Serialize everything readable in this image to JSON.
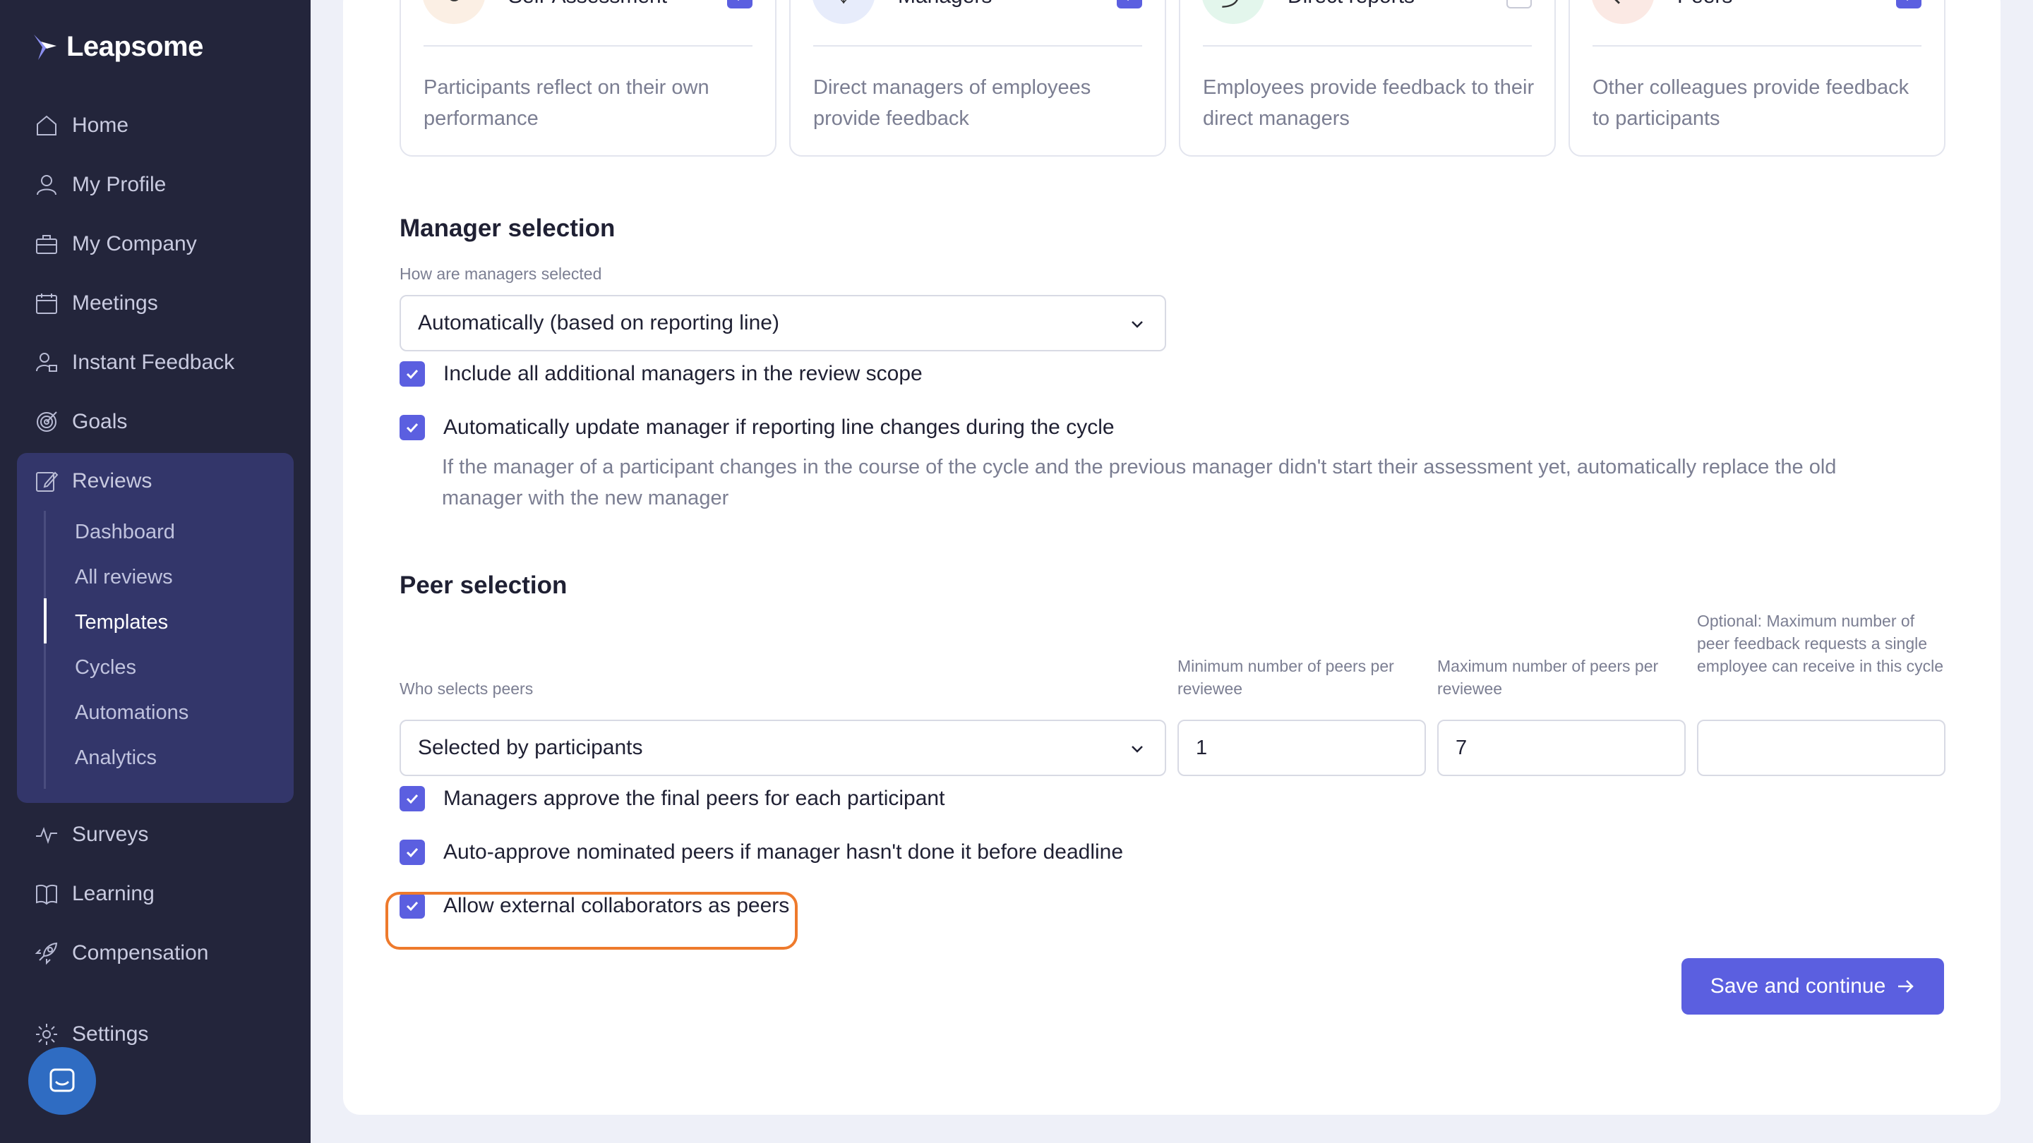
{
  "app": {
    "logo_text": "Leapsome",
    "brand_color": "#5b5fe0",
    "highlight_color": "#ee7a2c"
  },
  "sidebar": {
    "items": [
      {
        "label": "Home",
        "icon": "home-icon"
      },
      {
        "label": "My Profile",
        "icon": "user-icon"
      },
      {
        "label": "My Company",
        "icon": "briefcase-icon"
      },
      {
        "label": "Meetings",
        "icon": "calendar-icon"
      },
      {
        "label": "Instant Feedback",
        "icon": "feedback-icon"
      },
      {
        "label": "Goals",
        "icon": "target-icon"
      },
      {
        "label": "Reviews",
        "icon": "edit-icon"
      },
      {
        "label": "Surveys",
        "icon": "pulse-icon"
      },
      {
        "label": "Learning",
        "icon": "book-icon"
      },
      {
        "label": "Compensation",
        "icon": "rocket-icon"
      },
      {
        "label": "Settings",
        "icon": "gear-icon"
      }
    ],
    "reviews_sub": [
      "Dashboard",
      "All reviews",
      "Templates",
      "Cycles",
      "Automations",
      "Analytics"
    ],
    "active_sub": "Templates"
  },
  "providers": [
    {
      "title": "Self-Assessment",
      "desc": "Participants reflect on their own performance",
      "checked": true,
      "icon": "refresh-icon"
    },
    {
      "title": "Managers",
      "desc": "Direct managers of employees provide feedback",
      "checked": true,
      "icon": "arrow-down-icon"
    },
    {
      "title": "Direct reports",
      "desc": "Employees provide feedback to their direct managers",
      "checked": false,
      "icon": "arrow-up-icon"
    },
    {
      "title": "Peers",
      "desc": "Other colleagues provide feedback to participants",
      "checked": true,
      "icon": "swap-icon"
    }
  ],
  "manager_selection": {
    "title": "Manager selection",
    "label": "How are managers selected",
    "value": "Automatically (based on reporting line)",
    "include_additional": "Include all additional managers in the review scope",
    "auto_update": "Automatically update manager if reporting line changes during the cycle",
    "auto_update_help": "If the manager of a participant changes in the course of the cycle and the previous manager didn't start their assessment yet, automatically replace the old manager with the new manager"
  },
  "peer_selection": {
    "title": "Peer selection",
    "who_label": "Who selects peers",
    "who_value": "Selected by participants",
    "min_label": "Minimum number of peers per reviewee",
    "min_value": "1",
    "max_label": "Maximum number of peers per reviewee",
    "max_value": "7",
    "optional_label": "Optional: Maximum number of peer feedback requests a single employee can receive in this cycle",
    "optional_value": "",
    "approve": "Managers approve the final peers for each participant",
    "auto_approve": "Auto-approve nominated peers if manager hasn't done it before deadline",
    "external": "Allow external collaborators as peers"
  },
  "actions": {
    "save": "Save and continue"
  }
}
